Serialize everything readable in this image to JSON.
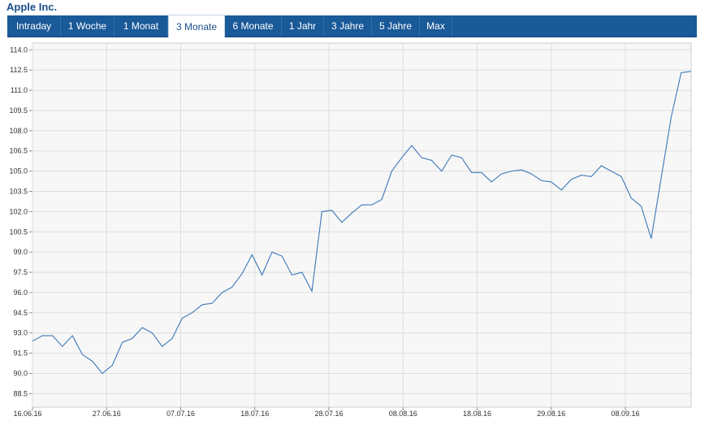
{
  "title": "Apple Inc.",
  "tabs": [
    {
      "label": "Intraday",
      "active": false
    },
    {
      "label": "1 Woche",
      "active": false
    },
    {
      "label": "1 Monat",
      "active": false
    },
    {
      "label": "3 Monate",
      "active": true
    },
    {
      "label": "6 Monate",
      "active": false
    },
    {
      "label": "1 Jahr",
      "active": false
    },
    {
      "label": "3 Jahre",
      "active": false
    },
    {
      "label": "5 Jahre",
      "active": false
    },
    {
      "label": "Max",
      "active": false
    }
  ],
  "colors": {
    "tabbar": "#1a5a99",
    "line": "#3b78b8",
    "grid": "#dddddd",
    "plot_bg": "#f7f7f7"
  },
  "chart_data": {
    "type": "line",
    "title": "",
    "xlabel": "",
    "ylabel": "",
    "ylim": [
      87.5,
      114.5
    ],
    "y_ticks": [
      "114.0",
      "112.5",
      "111.0",
      "109.5",
      "108.0",
      "106.5",
      "105.0",
      "103.5",
      "102.0",
      "100.5",
      "99.0",
      "97.5",
      "96.0",
      "94.5",
      "93.0",
      "91.5",
      "90.0",
      "88.5"
    ],
    "x_ticks": [
      "16.06.16",
      "27.06.16",
      "07.07.16",
      "18.07.16",
      "28.07.16",
      "08.08.16",
      "18.08.16",
      "29.08.16",
      "08.09.16"
    ],
    "grid": true,
    "series": [
      {
        "values": [
          92.4,
          92.8,
          92.8,
          92.0,
          92.8,
          91.4,
          90.9,
          90.0,
          90.6,
          92.3,
          92.6,
          93.4,
          93.0,
          92.0,
          92.6,
          94.1,
          94.5,
          95.1,
          95.2,
          96.0,
          96.4,
          97.4,
          98.8,
          97.3,
          99.0,
          98.7,
          97.3,
          97.5,
          96.1,
          102.0,
          102.1,
          101.2,
          101.9,
          102.5,
          102.5,
          102.9,
          105.0,
          106.0,
          106.9,
          106.0,
          105.8,
          105.0,
          106.2,
          106.0,
          104.9,
          104.9,
          104.2,
          104.8,
          105.0,
          105.1,
          104.8,
          104.3,
          104.2,
          103.6,
          104.4,
          104.7,
          104.6,
          105.4,
          105.0,
          104.6,
          103.0,
          102.4,
          100.0,
          104.5,
          109.0,
          112.3,
          112.4
        ]
      }
    ]
  }
}
